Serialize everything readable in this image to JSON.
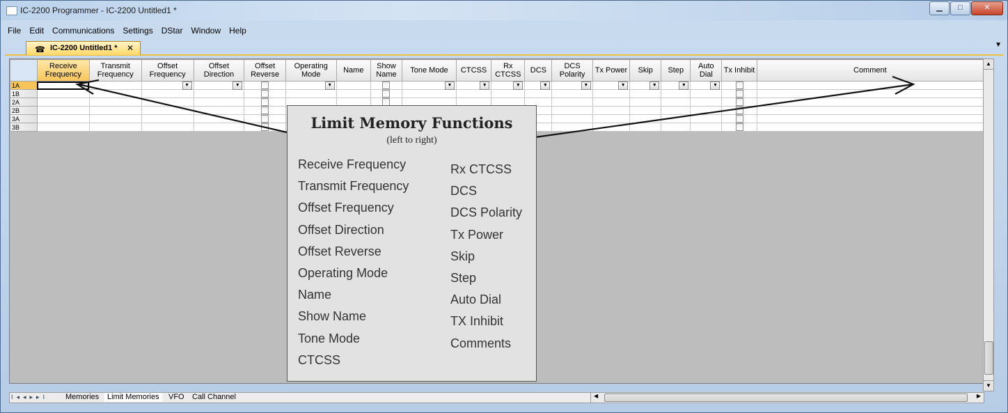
{
  "window": {
    "title": "IC-2200 Programmer - IC-2200 Untitled1 *",
    "minimize_label": "▁",
    "maximize_label": "□",
    "close_label": "✕"
  },
  "menu": [
    "File",
    "Edit",
    "Communications",
    "Settings",
    "DStar",
    "Window",
    "Help"
  ],
  "doc_tab": {
    "label": "IC-2200 Untitled1 *",
    "close_label": "✕",
    "dropdown_label": "▼"
  },
  "grid": {
    "columns": [
      "Receive Frequency",
      "Transmit Frequency",
      "Offset Frequency",
      "Offset Direction",
      "Offset Reverse",
      "Operating Mode",
      "Name",
      "Show Name",
      "Tone Mode",
      "CTCSS",
      "Rx CTCSS",
      "DCS",
      "DCS Polarity",
      "Tx Power",
      "Skip",
      "Step",
      "Auto Dial",
      "Tx Inhibit",
      "Comment"
    ],
    "rows": [
      "1A",
      "1B",
      "2A",
      "2B",
      "3A",
      "3B"
    ]
  },
  "sheet_tabs": [
    "Memories",
    "Limit Memories",
    "VFO",
    "Call Channel"
  ],
  "callout": {
    "title": "Limit Memory Functions",
    "subtitle": "(left to right)",
    "left_column": [
      "Receive Frequency",
      "Transmit Frequency",
      "Offset Frequency",
      "Offset Direction",
      "Offset Reverse",
      "Operating Mode",
      "Name",
      "Show Name",
      "Tone Mode",
      "CTCSS"
    ],
    "right_column": [
      "Rx CTCSS",
      "DCS",
      "DCS Polarity",
      "Tx Power",
      "Skip",
      "Step",
      "Auto Dial",
      "TX Inhibit",
      "Comments"
    ]
  },
  "colors": {
    "active_header": "#f7c45a",
    "callout_bg": "#e2e2e2",
    "grid_empty": "#bdbdbd"
  }
}
